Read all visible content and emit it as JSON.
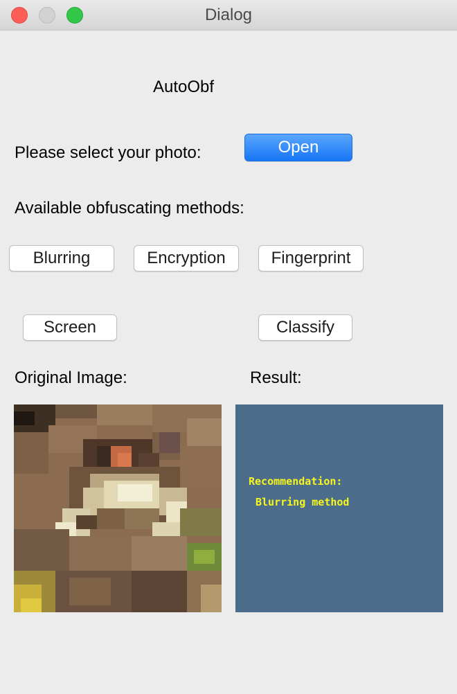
{
  "window": {
    "title": "Dialog"
  },
  "main": {
    "app_title": "AutoObf",
    "select_prompt": "Please select your photo:",
    "open_label": "Open",
    "methods_label": "Available obfuscating methods:",
    "buttons": {
      "blurring": "Blurring",
      "encryption": "Encryption",
      "fingerprint": "Fingerprint",
      "screen": "Screen",
      "classify": "Classify"
    },
    "original_label": "Original Image:",
    "result_label": "Result:"
  },
  "result": {
    "line1": "Recommendation:",
    "line2": "Blurring method",
    "background_color": "#4b6d8b",
    "text_color": "#f7f71d"
  },
  "colors": {
    "accent": "#1676f6",
    "window_bg": "#ececec"
  }
}
